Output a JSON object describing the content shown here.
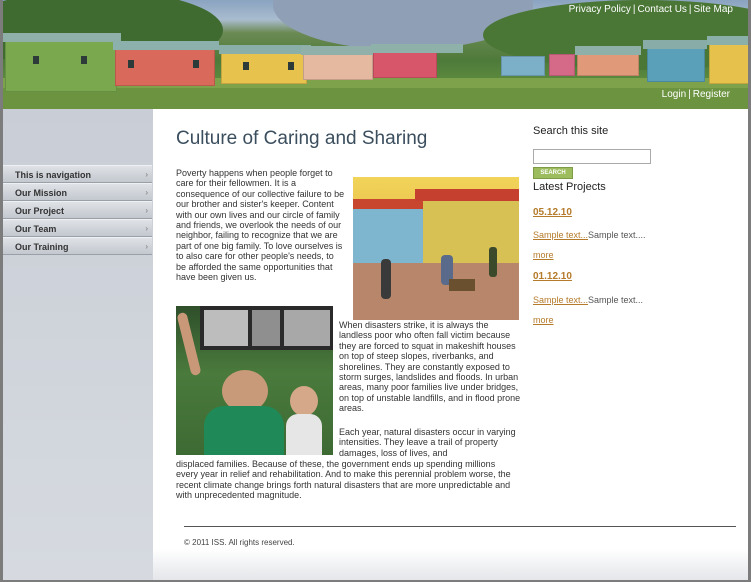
{
  "header": {
    "top_links": [
      "Privacy Policy",
      "Contact Us",
      "Site Map"
    ],
    "user_links": [
      "Login",
      "Register"
    ]
  },
  "nav": {
    "items": [
      {
        "label": "This is navigation"
      },
      {
        "label": "Our Mission"
      },
      {
        "label": "Our Project"
      },
      {
        "label": "Our Team"
      },
      {
        "label": "Our Training"
      }
    ]
  },
  "main": {
    "title": "Culture of Caring and Sharing",
    "paragraph1": "Poverty happens when people forget to care for their fellowmen. It is a consequence of our collective failure to be our brother and sister's keeper. Content with our own lives and our circle of family and friends, we overlook the needs of our neighbor, failing to recognize that we are part of one big family. To love ourselves is to also care for other people's needs, to be afforded the same opportunities that have been given us.",
    "paragraph2": "When disasters strike, it is always the landless poor who often fall victim because they are forced to squat in makeshift houses on top of steep slopes, riverbanks, and shorelines. They are constantly exposed to storm surges, landslides and floods. In urban areas, many poor families live under bridges, on top of unstable landfills, and in flood prone areas.",
    "paragraph3a": "Each year, natural disasters occur in varying intensities. They leave a trail of property damages, loss of lives, and",
    "paragraph3b": "displaced families. Because of these, the government ends up spending millions every year in relief and rehabilitation. And to make this perennial problem worse, the recent climate change brings forth natural disasters that are more unpredictable and with unprecedented magnitude."
  },
  "sidebar": {
    "search_title": "Search this site",
    "search_placeholder": "",
    "search_button": "SEARCH",
    "projects_title": "Latest Projects",
    "projects": [
      {
        "date": "05.12.10",
        "link": "Sample text...",
        "text": "Sample text....",
        "more": "more"
      },
      {
        "date": "01.12.10",
        "link": "Sample text...",
        "text": "Sample text...",
        "more": "more"
      }
    ]
  },
  "footer": {
    "copyright": "© 2011 ISS. All rights reserved."
  },
  "colors": {
    "accent": "#b57a2a",
    "title": "#3b4e5e",
    "search_button": "#9cbc5e"
  }
}
